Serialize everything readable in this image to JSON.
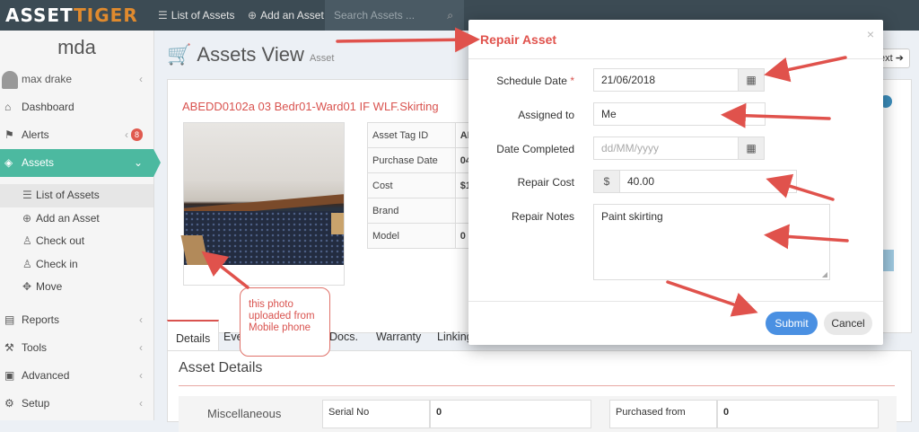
{
  "topbar": {
    "logo_part1": "ASSET",
    "logo_part2": "TIGER",
    "nav_list": "List of Assets",
    "nav_add": "Add an Asset",
    "search_placeholder": "Search Assets ..."
  },
  "sidebar": {
    "title": "mda",
    "user": "max drake",
    "items": [
      {
        "label": "Dashboard",
        "icon": "home-icon"
      },
      {
        "label": "Alerts",
        "icon": "flag-icon",
        "badge": "8"
      },
      {
        "label": "Assets",
        "icon": "tag-icon"
      },
      {
        "label": "Reports",
        "icon": "report-icon"
      },
      {
        "label": "Tools",
        "icon": "wrench-icon"
      },
      {
        "label": "Advanced",
        "icon": "briefcase-icon"
      },
      {
        "label": "Setup",
        "icon": "gear-icon"
      }
    ],
    "subitems": [
      {
        "label": "List of Assets"
      },
      {
        "label": "Add an Asset"
      },
      {
        "label": "Check out"
      },
      {
        "label": "Check in"
      },
      {
        "label": "Move"
      }
    ]
  },
  "page": {
    "title": "Assets View",
    "subtitle": "Asset",
    "asset_name": "ABEDD0102a 03 Bedr01-Ward01 IF WLF.Skirting",
    "next_label": "ext",
    "table": [
      {
        "label": "Asset Tag ID",
        "value": "AE"
      },
      {
        "label": "Purchase Date",
        "value": "04"
      },
      {
        "label": "Cost",
        "value": "$1"
      },
      {
        "label": "Brand",
        "value": ""
      },
      {
        "label": "Model",
        "value": "0"
      }
    ],
    "callout": "this photo uploaded from Mobile phone",
    "tabs": [
      "Details",
      "Eve",
      "Docs.",
      "Warranty",
      "Linking"
    ],
    "details_title": "Asset Details",
    "misc_label": "Miscellaneous",
    "serial_label": "Serial No",
    "serial_value": "0",
    "purchased_label": "Purchased from",
    "purchased_value": "0"
  },
  "modal": {
    "title": "Repair Asset",
    "close": "×",
    "schedule_label": "Schedule Date",
    "schedule_value": "21/06/2018",
    "assigned_label": "Assigned to",
    "assigned_value": "Me",
    "completed_label": "Date Completed",
    "completed_placeholder": "dd/MM/yyyy",
    "cost_label": "Repair Cost",
    "cost_prefix": "$",
    "cost_value": "40.00",
    "notes_label": "Repair Notes",
    "notes_value": "Paint skirting",
    "submit": "Submit",
    "cancel": "Cancel"
  },
  "colors": {
    "accent_teal": "#4cb9a0",
    "accent_red": "#d9534f",
    "submit_blue": "#4a90e2",
    "topbar": "#3c4b54"
  }
}
